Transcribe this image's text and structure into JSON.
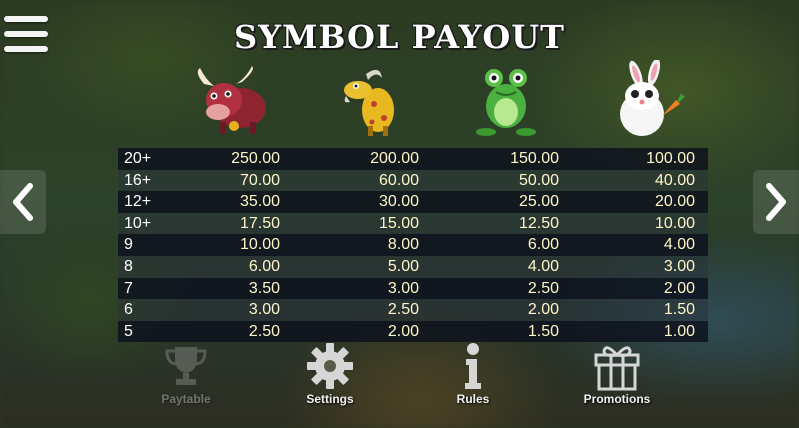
{
  "title": "SYMBOL PAYOUT",
  "symbols": [
    {
      "name": "bull-icon"
    },
    {
      "name": "goat-icon"
    },
    {
      "name": "frog-icon"
    },
    {
      "name": "rabbit-icon"
    }
  ],
  "rows": [
    {
      "count": "20+",
      "values": [
        "250.00",
        "200.00",
        "150.00",
        "100.00"
      ]
    },
    {
      "count": "16+",
      "values": [
        "70.00",
        "60.00",
        "50.00",
        "40.00"
      ]
    },
    {
      "count": "12+",
      "values": [
        "35.00",
        "30.00",
        "25.00",
        "20.00"
      ]
    },
    {
      "count": "10+",
      "values": [
        "17.50",
        "15.00",
        "12.50",
        "10.00"
      ]
    },
    {
      "count": "9",
      "values": [
        "10.00",
        "8.00",
        "6.00",
        "4.00"
      ]
    },
    {
      "count": "8",
      "values": [
        "6.00",
        "5.00",
        "4.00",
        "3.00"
      ]
    },
    {
      "count": "7",
      "values": [
        "3.50",
        "3.00",
        "2.50",
        "2.00"
      ]
    },
    {
      "count": "6",
      "values": [
        "3.00",
        "2.50",
        "2.00",
        "1.50"
      ]
    },
    {
      "count": "5",
      "values": [
        "2.50",
        "2.00",
        "1.50",
        "1.00"
      ]
    }
  ],
  "nav": {
    "paytable": "Paytable",
    "settings": "Settings",
    "rules": "Rules",
    "promotions": "Promotions"
  },
  "icons": {
    "menu": "hamburger-menu-icon",
    "left": "chevron-left-icon",
    "right": "chevron-right-icon",
    "paytable": "trophy-icon",
    "settings": "gear-icon",
    "rules": "info-icon",
    "promotions": "gift-icon"
  },
  "colors": {
    "value_text": "#fff6c8",
    "row_dark": "#0a0e1c",
    "title": "#ffffff"
  }
}
